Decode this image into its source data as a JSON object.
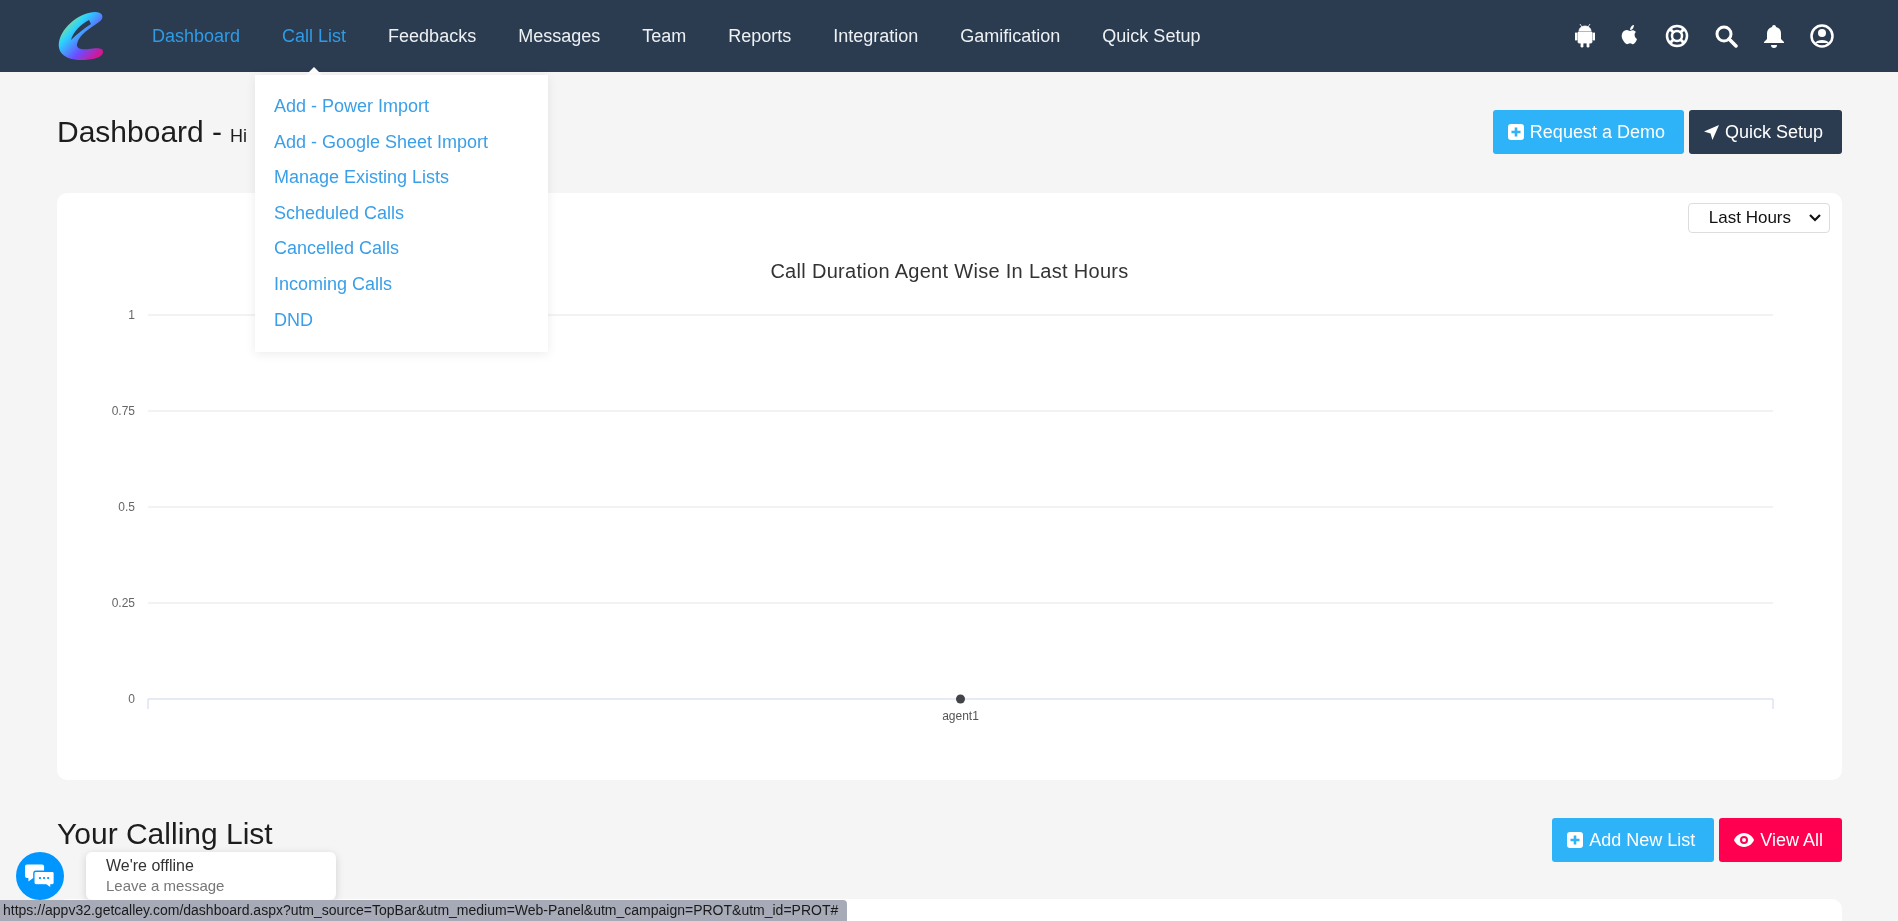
{
  "nav": {
    "items": [
      {
        "label": "Dashboard",
        "selected": true,
        "expanded": false
      },
      {
        "label": "Call List",
        "selected": true,
        "expanded": true
      },
      {
        "label": "Feedbacks",
        "selected": false,
        "expanded": false
      },
      {
        "label": "Messages",
        "selected": false,
        "expanded": false
      },
      {
        "label": "Team",
        "selected": false,
        "expanded": false
      },
      {
        "label": "Reports",
        "selected": false,
        "expanded": false
      },
      {
        "label": "Integration",
        "selected": false,
        "expanded": false
      },
      {
        "label": "Gamification",
        "selected": false,
        "expanded": false
      },
      {
        "label": "Quick Setup",
        "selected": false,
        "expanded": false
      }
    ],
    "dropdown": {
      "items": [
        "Add - Power Import",
        "Add - Google Sheet Import",
        "Manage Existing Lists",
        "Scheduled Calls",
        "Cancelled Calls",
        "Incoming Calls",
        "DND"
      ]
    }
  },
  "header": {
    "title": "Dashboard -",
    "greeting": "Hi",
    "buttons": [
      {
        "label": "Request a Demo",
        "kind": "add"
      },
      {
        "label": "Quick Setup",
        "kind": "setup"
      }
    ]
  },
  "chart_card": {
    "range": "Last Hours",
    "chart_data": {
      "type": "line",
      "title": "Call Duration Agent Wise In Last Hours",
      "categories": [
        "agent1"
      ],
      "values": [
        0
      ],
      "grid": true,
      "marker": true,
      "ylim": [
        0,
        1
      ],
      "yticks": [
        0,
        0.25,
        0.5,
        0.75,
        1
      ]
    }
  },
  "calling_list": {
    "title": "Your Calling List",
    "buttons": [
      {
        "label": "Add New List",
        "kind": "add"
      },
      {
        "label": "View All",
        "kind": "view"
      }
    ]
  },
  "chat": {
    "status": "We're offline",
    "prompt": "Leave a message"
  },
  "status_bar": {
    "url": "https://appv32.getcalley.com/dashboard.aspx?utm_source=TopBar&utm_medium=Web-Panel&utm_campaign=PROT&utm_id=PROT#"
  }
}
